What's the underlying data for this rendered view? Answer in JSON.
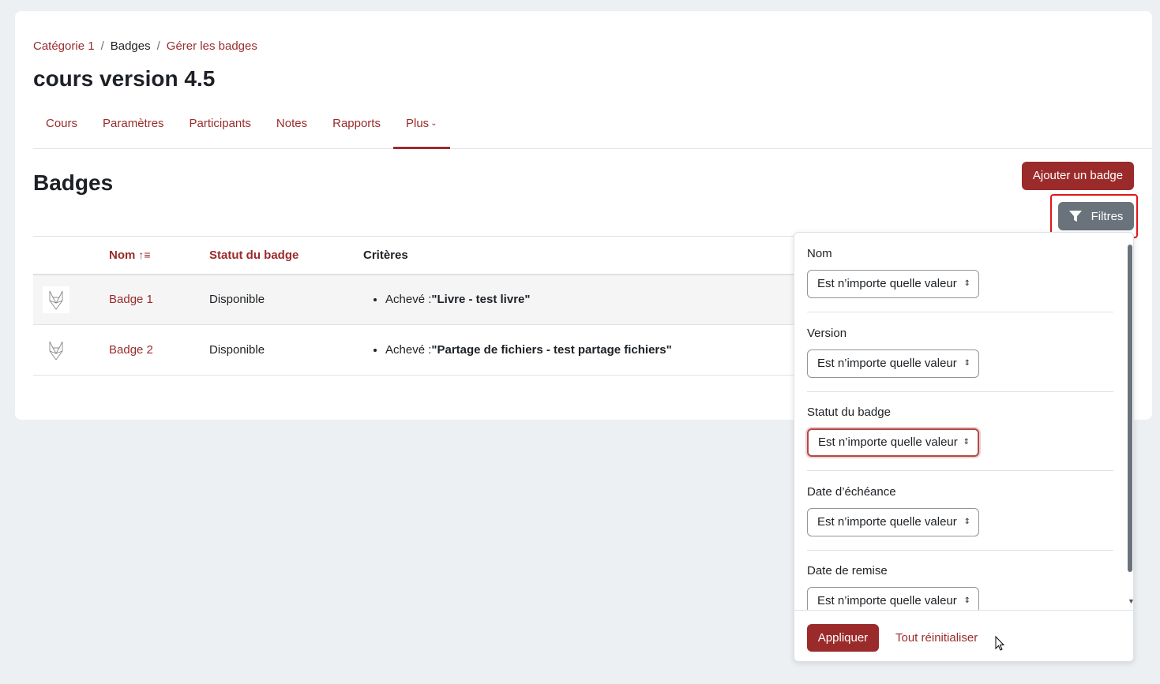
{
  "breadcrumb": {
    "items": [
      "Catégorie 1",
      "Badges",
      "Gérer les badges"
    ],
    "separator": "/"
  },
  "course_title": "cours version 4.5",
  "nav": {
    "tabs": [
      {
        "label": "Cours"
      },
      {
        "label": "Paramètres"
      },
      {
        "label": "Participants"
      },
      {
        "label": "Notes"
      },
      {
        "label": "Rapports"
      },
      {
        "label": "Plus",
        "active": true
      }
    ]
  },
  "badges_heading": "Badges",
  "add_badge_label": "Ajouter un badge",
  "filters_label": "Filtres",
  "table": {
    "columns": [
      "Nom",
      "Statut du badge",
      "Critères"
    ],
    "rows": [
      {
        "name": "Badge 1",
        "status": "Disponible",
        "criteria_prefix": "Achevé :",
        "criteria_value": "\"Livre - test livre\""
      },
      {
        "name": "Badge 2",
        "status": "Disponible",
        "criteria_prefix": "Achevé :",
        "criteria_value": "\"Partage de fichiers - test partage fichiers\""
      }
    ]
  },
  "filter_panel": {
    "groups": [
      {
        "label": "Nom",
        "value": "Est n’importe quelle valeur"
      },
      {
        "label": "Version",
        "value": "Est n’importe quelle valeur"
      },
      {
        "label": "Statut du badge",
        "value": "Est n’importe quelle valeur"
      },
      {
        "label": "Date d’échéance",
        "value": "Est n’importe quelle valeur"
      },
      {
        "label": "Date de remise",
        "value": "Est n’importe quelle valeur"
      }
    ],
    "apply_label": "Appliquer",
    "reset_label": "Tout réinitialiser"
  },
  "colors": {
    "brand": "#9b2b2b",
    "secondary": "#6a737b",
    "highlight": "#e3151a"
  }
}
